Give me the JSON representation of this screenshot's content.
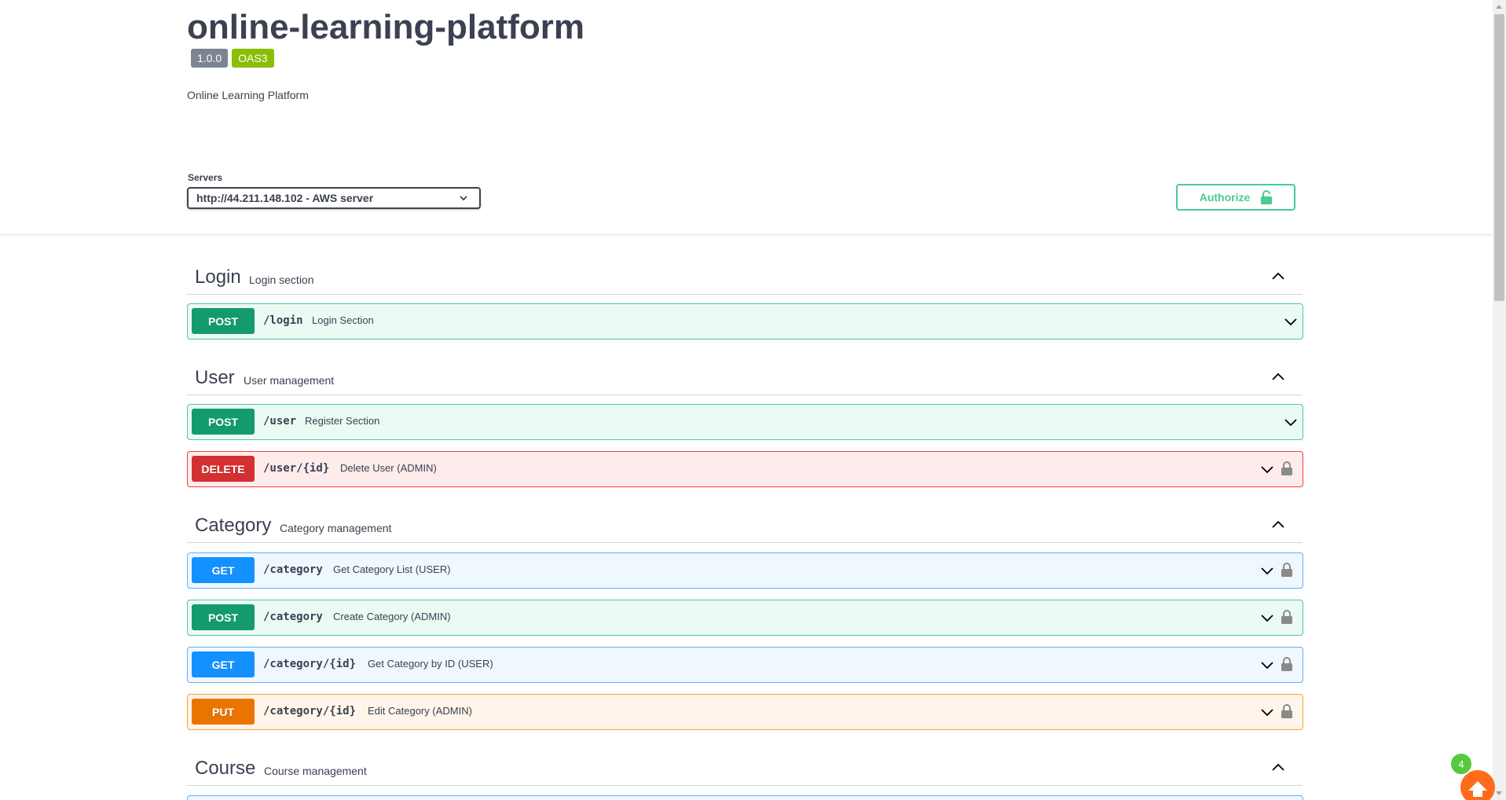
{
  "info": {
    "title": "online-learning-platform",
    "version": "1.0.0",
    "oas": "OAS3",
    "description": "Online Learning Platform"
  },
  "servers": {
    "label": "Servers",
    "selected": "http://44.211.148.102 - AWS server"
  },
  "authorize": {
    "label": "Authorize"
  },
  "tags": [
    {
      "name": "Login",
      "description": "Login section",
      "operations": [
        {
          "method": "POST",
          "path": "/login",
          "summary": "Login Section",
          "locked": false
        }
      ]
    },
    {
      "name": "User",
      "description": "User management",
      "operations": [
        {
          "method": "POST",
          "path": "/user",
          "summary": "Register Section",
          "locked": false
        },
        {
          "method": "DELETE",
          "path": "/user/{id}",
          "summary": "Delete User (ADMIN)",
          "locked": true
        }
      ]
    },
    {
      "name": "Category",
      "description": "Category management",
      "operations": [
        {
          "method": "GET",
          "path": "/category",
          "summary": "Get Category List (USER)",
          "locked": true
        },
        {
          "method": "POST",
          "path": "/category",
          "summary": "Create Category (ADMIN)",
          "locked": true
        },
        {
          "method": "GET",
          "path": "/category/{id}",
          "summary": "Get Category by ID (USER)",
          "locked": true
        },
        {
          "method": "PUT",
          "path": "/category/{id}",
          "summary": "Edit Category (ADMIN)",
          "locked": true
        }
      ]
    },
    {
      "name": "Course",
      "description": "Course management",
      "operations": []
    }
  ],
  "widget": {
    "count": "4"
  },
  "colors": {
    "post": "#49cc90",
    "get": "#61affe",
    "put": "#fca130",
    "delete": "#f93e3e"
  }
}
